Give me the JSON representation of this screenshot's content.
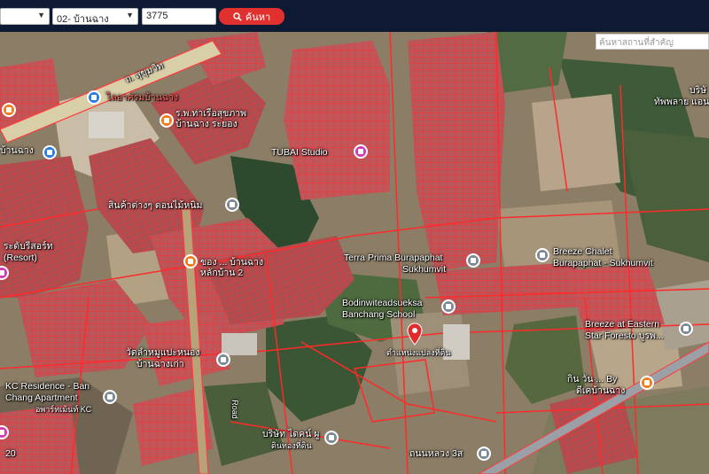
{
  "toolbar": {
    "province_value": "",
    "district_value": "02- บ้านฉาง",
    "parcel_value": "3775",
    "search_label": "ค้นหา"
  },
  "map": {
    "place_search_placeholder": "ค้นหาสถานที่สำคัญ",
    "labels": {
      "sukhumvit_road": "ถ. สุขุมวิท",
      "school_top": "ไลอาศรมบ้านฉาง",
      "hospital_top": "ร.พ.ท่าเรือสุขภาพ บ้านฉาง ระยอง",
      "banchang_left": "บ้านฉาง",
      "tubai_studio": "TUBAI Studio",
      "nong_market": "สินค้าต่างๆ ดอนไม้หนิม",
      "right_top_a": "บริษั",
      "right_top_b": "ทัพพลาย แอนด",
      "resort_left_a": "ระดับรีสอร์ท",
      "resort_left_b": "(Resort)",
      "school_mid": "ของ ... บ้านฉาง หลักบ้าน 2",
      "terra_prima_a": "Terra Prima Burapaphat",
      "terra_prima_b": "Sukhumvit",
      "breeze_chalet_a": "Breeze Chalet",
      "breeze_chalet_b": "Burapaphat - Sukhumvit",
      "bodin_a": "Bodinwiteadsueksa",
      "bodin_b": "Banchang School",
      "breeze_eastern_a": "Breeze at Eastern",
      "breeze_eastern_b": "Star Foresto บูรพ...",
      "pin_label": "ตำแหน่งแปลงที่ดิน",
      "temple_a": "วัดลำหมูแปะหนอง",
      "temple_b": "บ้านฉางเก่า",
      "kc_a": "KC Residence - Ban",
      "kc_b": "Chang Apartment",
      "kc_c": "อพาร์ทเม้นท์ KC",
      "road_vertical": "Road",
      "company": "บริษัท ไดคน์ ผู",
      "company_b": "ดินทองที่ดิน",
      "kin_wan": "กิน วัน ... By",
      "kin_wan_b": "ดีเคบ้านฉาง",
      "bottom_road": "ถนนหลวง 3ส",
      "bottom_left": "20"
    }
  },
  "colors": {
    "topbar_bg": "#0e1a33",
    "search_button": "#e0312e",
    "parcel_line": "#ff2a2a",
    "poi_gray": "#7d8a95",
    "poi_blue": "#2a7de1",
    "poi_orange": "#f07c1e",
    "poi_pink": "#d43ab3",
    "pin": "#e02b2b"
  },
  "icons": [
    "chevron-down-icon",
    "search-icon",
    "map-pin-icon",
    "poi-icon"
  ]
}
